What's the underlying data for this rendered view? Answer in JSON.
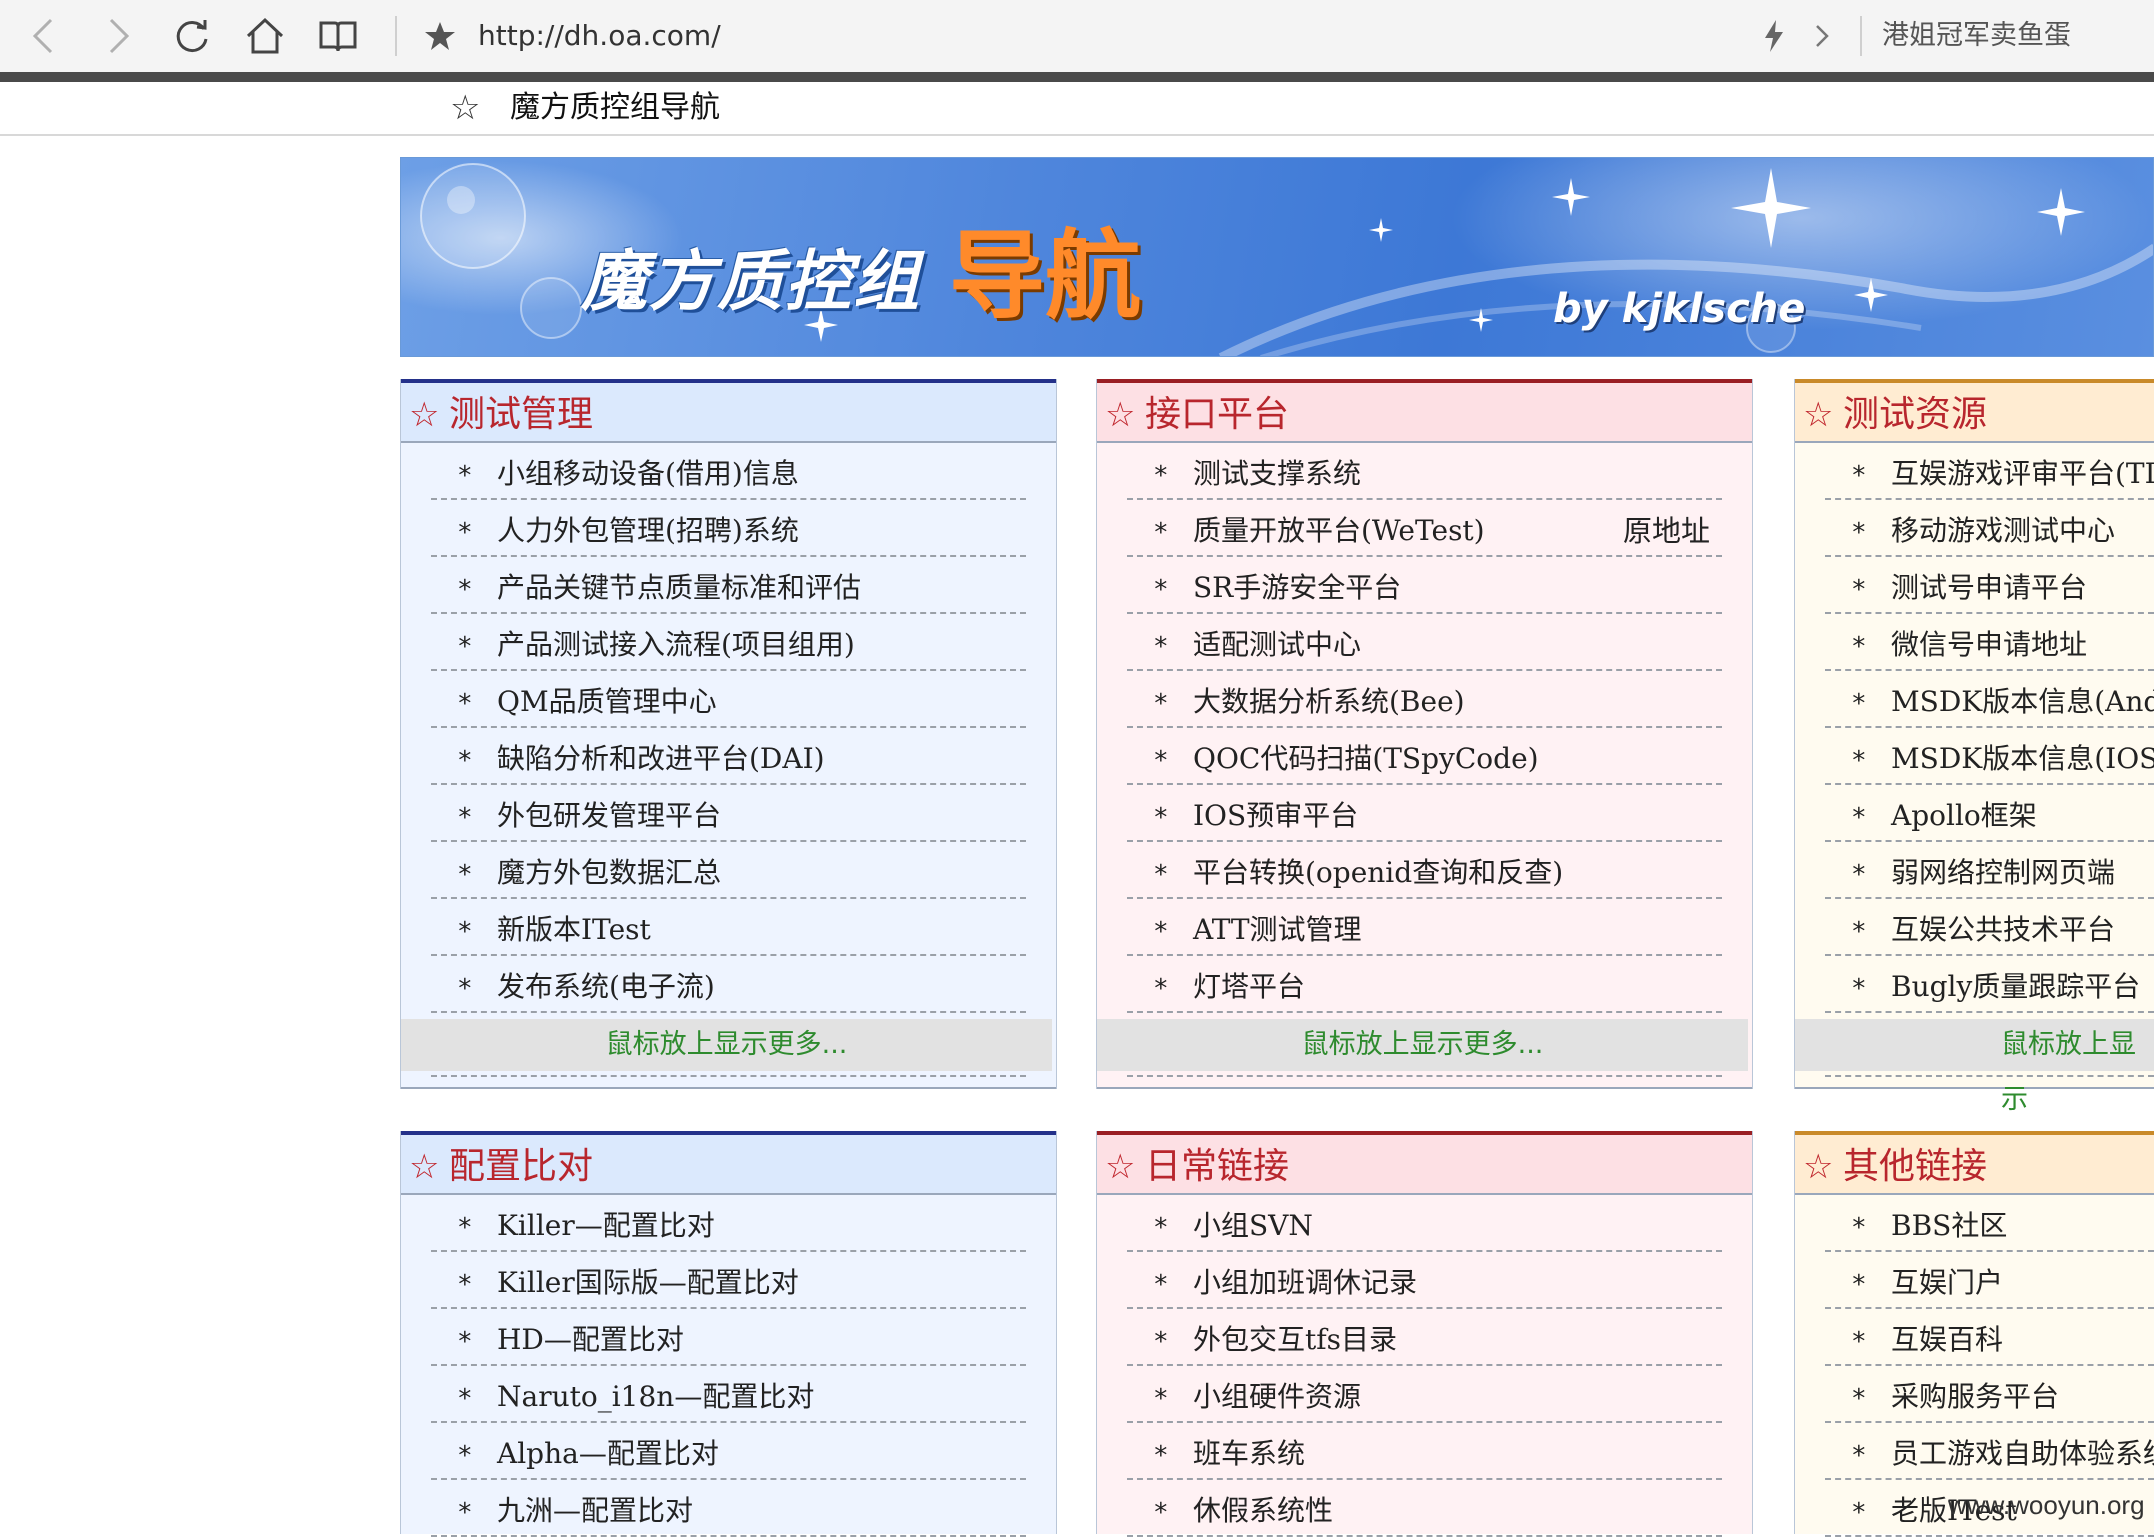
{
  "browser": {
    "url": "http://dh.oa.com/",
    "right_text": "港姐冠军卖鱼蛋"
  },
  "bookmarks": {
    "items": [
      {
        "label": "魔方质控组导航"
      }
    ]
  },
  "banner": {
    "title": "魔方质控组",
    "subtitle": "导航",
    "by": "by kjklsche"
  },
  "panels": {
    "test_mgmt": {
      "title": "测试管理",
      "items": [
        "小组移动设备(借用)信息",
        "人力外包管理(招聘)系统",
        "产品关键节点质量标准和评估",
        "产品测试接入流程(项目组用)",
        "QM品质管理中心",
        "缺陷分析和改进平台(DAI)",
        "外包研发管理平台",
        "魔方外包数据汇总",
        "新版本ITest",
        "发布系统(电子流)"
      ],
      "more": "鼠标放上显示更多..."
    },
    "api_platform": {
      "title": "接口平台",
      "items": [
        "测试支撑系统",
        "质量开放平台(WeTest)",
        "SR手游安全平台",
        "适配测试中心",
        "大数据分析系统(Bee)",
        "QOC代码扫描(TSpyCode)",
        "IOS预审平台",
        "平台转换(openid查询和反查)",
        "ATT测试管理",
        "灯塔平台"
      ],
      "extra": "原地址",
      "more": "鼠标放上显示更多..."
    },
    "test_resources": {
      "title": "测试资源",
      "items": [
        "互娱游戏评审平台(TD",
        "移动游戏测试中心",
        "测试号申请平台",
        "微信号申请地址",
        "MSDK版本信息(Androi",
        "MSDK版本信息(IOS版)",
        "Apollo框架",
        "弱网络控制网页端",
        "互娱公共技术平台",
        "Bugly质量跟踪平台"
      ],
      "more": "鼠标放上显示"
    },
    "config_compare": {
      "title": "配置比对",
      "items": [
        "Killer—配置比对",
        "Killer国际版—配置比对",
        "HD—配置比对",
        "Naruto_i18n—配置比对",
        "Alpha—配置比对",
        "九洲—配置比对"
      ]
    },
    "daily_links": {
      "title": "日常链接",
      "items": [
        "小组SVN",
        "小组加班调休记录",
        "外包交互tfs目录",
        "小组硬件资源",
        "班车系统",
        "休假系统性"
      ]
    },
    "other_links": {
      "title": "其他链接",
      "items": [
        "BBS社区",
        "互娱门户",
        "互娱百科",
        "采购服务平台",
        "员工游戏自助体验系统",
        "老版ITest"
      ]
    }
  },
  "watermark": "www.wooyun.org"
}
